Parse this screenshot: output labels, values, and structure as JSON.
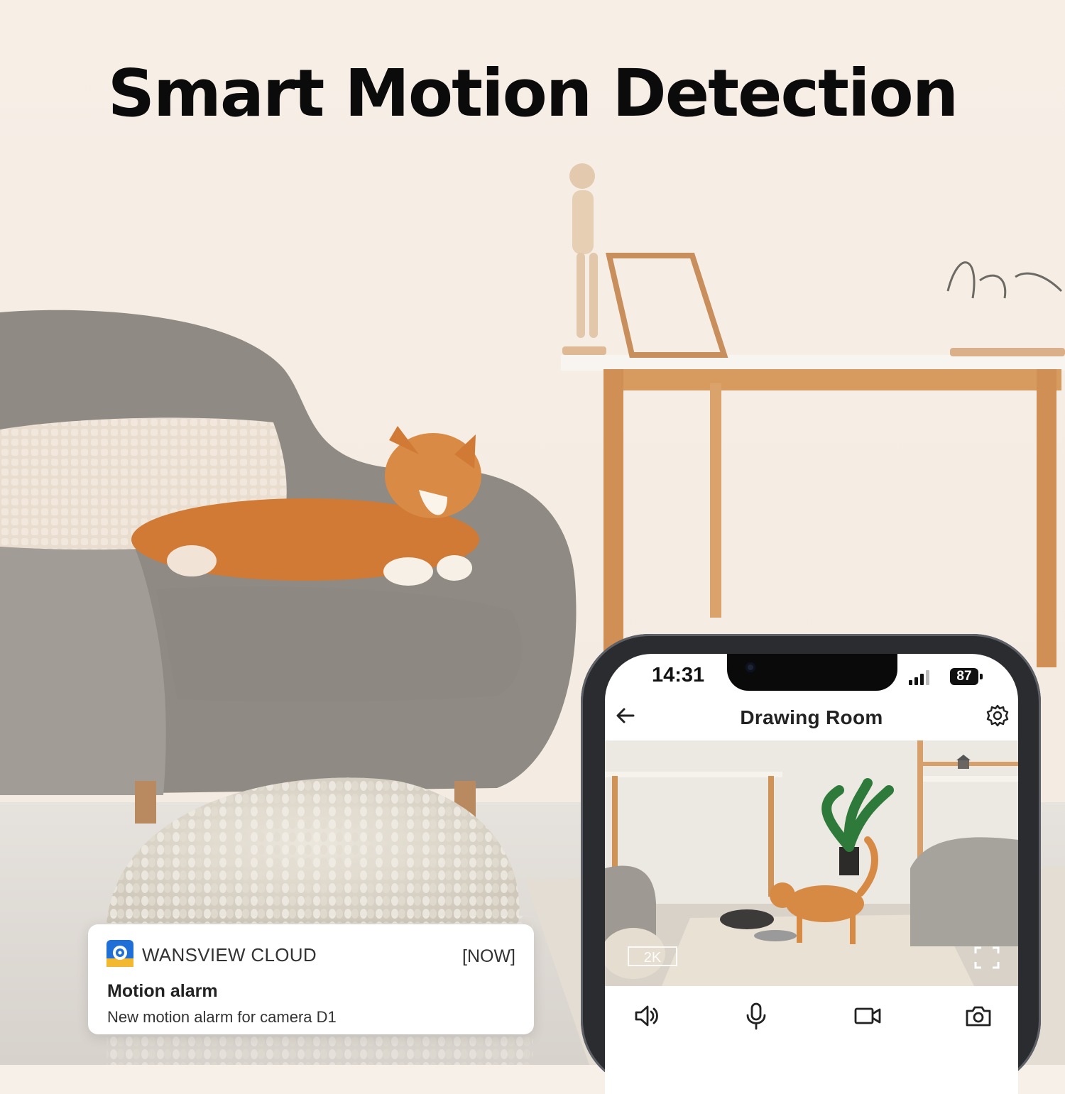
{
  "headline": "Smart Motion Detection",
  "notification": {
    "app_icon": "wansview-app-icon",
    "app_name": "WANSVIEW CLOUD",
    "time": "[NOW]",
    "title": "Motion alarm",
    "body": "New motion alarm for camera D1"
  },
  "phone": {
    "status_bar": {
      "time": "14:31",
      "battery": "87",
      "icons": [
        "signal-icon",
        "battery-icon"
      ]
    },
    "header": {
      "title": "Drawing Room",
      "back_icon": "back-arrow-icon",
      "settings_icon": "gear-icon"
    },
    "feed": {
      "quality_badge": "2K",
      "fullscreen_icon": "fullscreen-icon"
    },
    "controls": [
      "speaker-icon",
      "microphone-icon",
      "record-video-icon",
      "snapshot-camera-icon"
    ]
  },
  "colors": {
    "accent_blue": "#1f6fd6",
    "text_dark": "#222222",
    "phone_frame": "#2b2c30"
  }
}
